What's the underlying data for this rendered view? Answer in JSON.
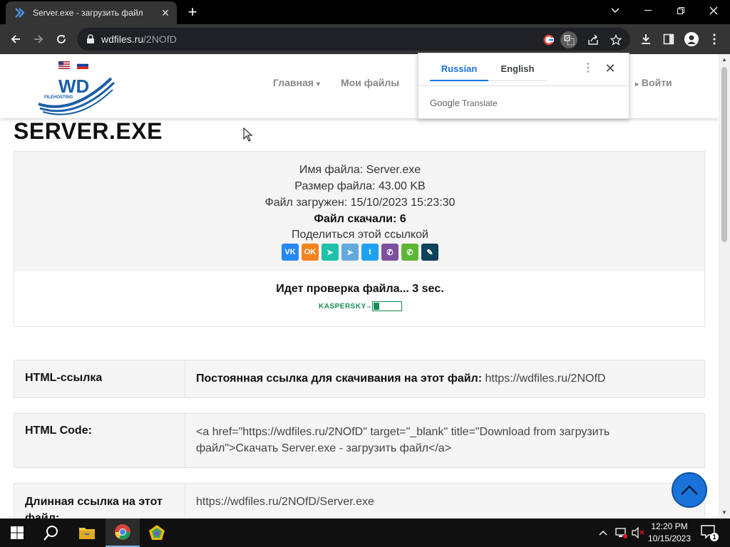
{
  "browser": {
    "tab_title": "Server.exe - загрузить файл",
    "url_host": "wdfiles.ru",
    "url_path": "/2NOfD",
    "accent": "#1a73e8"
  },
  "translate_popup": {
    "lang_source": "Russian",
    "lang_target": "English",
    "brand_google": "Google",
    "brand_translate": "Translate"
  },
  "site": {
    "logo_text": "WD",
    "logo_sub": "FILEHOSTING",
    "nav": {
      "home": "Главная",
      "my_files": "Мои файлы",
      "login": "Войти"
    }
  },
  "file": {
    "title": "SERVER.EXE",
    "name_line": "Имя файла: Server.exe",
    "size_line": "Размер файла: 43.00 KB",
    "uploaded_line": "Файл загружен: 15/10/2023 15:23:30",
    "downloads_line": "Файл скачали: 6",
    "share_label": "Поделиться этой ссылкой",
    "share_buttons": [
      {
        "icon": "vk-icon",
        "glyph": "VK",
        "color": "#2787f5"
      },
      {
        "icon": "odnoklassniki-icon",
        "glyph": "OK",
        "color": "#f4821e"
      },
      {
        "icon": "sms-icon",
        "glyph": "➤",
        "color": "#20c1ab"
      },
      {
        "icon": "telegram-icon",
        "glyph": "➤",
        "color": "#64a9dc"
      },
      {
        "icon": "twitter-icon",
        "glyph": "t",
        "color": "#1da1f2"
      },
      {
        "icon": "viber-icon",
        "glyph": "✆",
        "color": "#7d519e"
      },
      {
        "icon": "whatsapp-icon",
        "glyph": "✆",
        "color": "#5bb734"
      },
      {
        "icon": "livejournal-icon",
        "glyph": "✎",
        "color": "#0d425a"
      }
    ]
  },
  "check": {
    "status": "Идет проверка файла... 3 sec.",
    "kaspersky": "KASPERSKY",
    "kaspersky_mark": "lab",
    "progress": 0.2
  },
  "links": {
    "html_link_label": "HTML-ссылка",
    "html_link_prefix": "Постоянная ссылка для скачивания на этот файл:",
    "html_link_url": "https://wdfiles.ru/2NOfD",
    "html_code_label": "HTML Code:",
    "html_code_value": "<a href=\"https://wdfiles.ru/2NOfD\" target=\"_blank\" title=\"Download from загрузить файл\">Скачать Server.exe - загрузить файл</a>",
    "long_link_label": "Длинная ссылка на этот файл:",
    "long_link_url": "https://wdfiles.ru/2NOfD/Server.exe"
  },
  "taskbar": {
    "time": "12:20 PM",
    "date": "10/15/2023",
    "notifications": "1"
  }
}
